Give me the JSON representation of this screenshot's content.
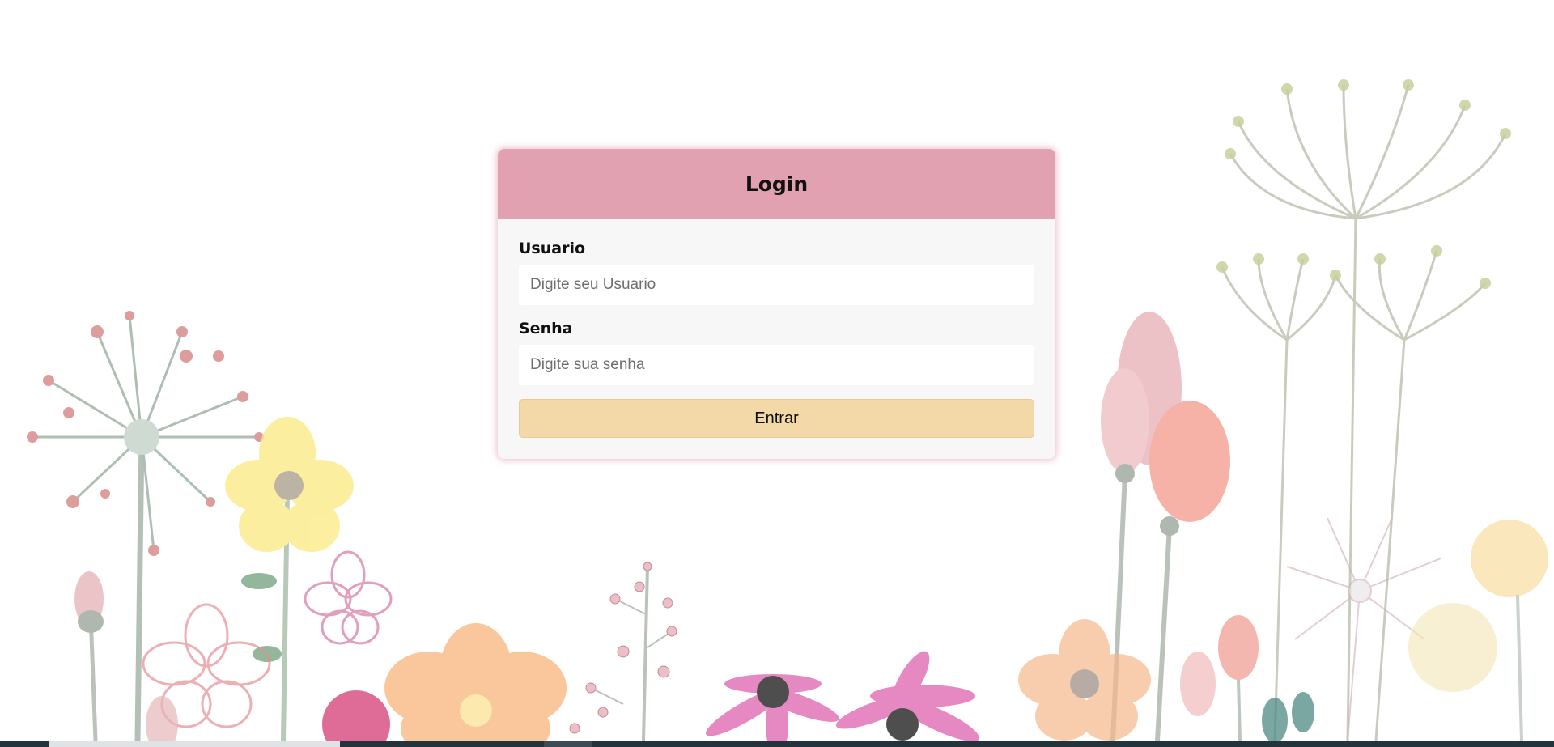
{
  "login": {
    "title": "Login",
    "username_label": "Usuario",
    "username_placeholder": "Digite seu Usuario",
    "username_value": "",
    "password_label": "Senha",
    "password_placeholder": "Digite sua senha",
    "password_value": "",
    "submit_label": "Entrar"
  },
  "colors": {
    "header": "#e2a1b0",
    "button": "#f3d8a8",
    "card": "#f7f7f7"
  },
  "icons": {
    "background": "floral-illustration"
  }
}
